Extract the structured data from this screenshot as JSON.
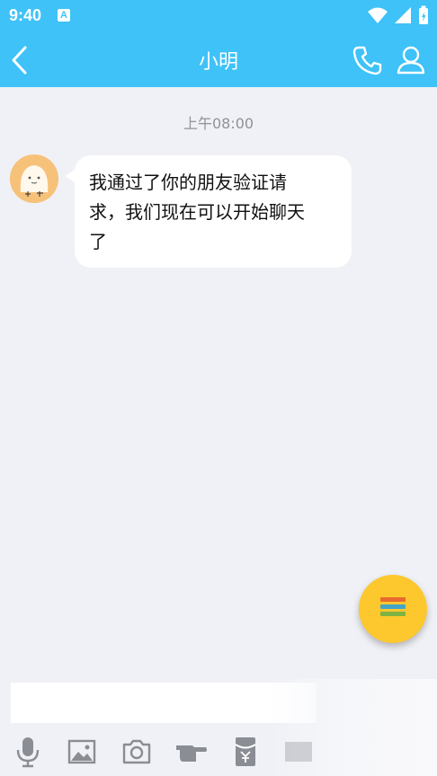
{
  "status_bar": {
    "time": "9:40",
    "notification_badge": "A",
    "icons": [
      "wifi-icon",
      "signal-icon",
      "battery-icon"
    ]
  },
  "header": {
    "title": "小明",
    "actions": [
      "back-icon",
      "phone-icon",
      "user-profile-icon"
    ]
  },
  "chat": {
    "timestamp": "上午08:00",
    "messages": [
      {
        "sender_avatar": "cartoon-avatar",
        "lines": [
          "我通过了你的朋友验证请",
          "求，我们现在可以开始聊天",
          "了"
        ]
      }
    ]
  },
  "fab": {
    "icon": "menu-icon",
    "bar_colors": [
      "#e86a2f",
      "#43a5c8",
      "#7cb342"
    ]
  },
  "toolbar": {
    "input_value": "",
    "tools": [
      "microphone-icon",
      "image-icon",
      "camera-icon",
      "poke-icon",
      "red-packet-icon",
      "more-icon"
    ]
  },
  "colors": {
    "primary": "#3ec2f8",
    "background": "#f0f1f6",
    "fab": "#fdc72e",
    "icon_gray": "#8a8d93"
  }
}
